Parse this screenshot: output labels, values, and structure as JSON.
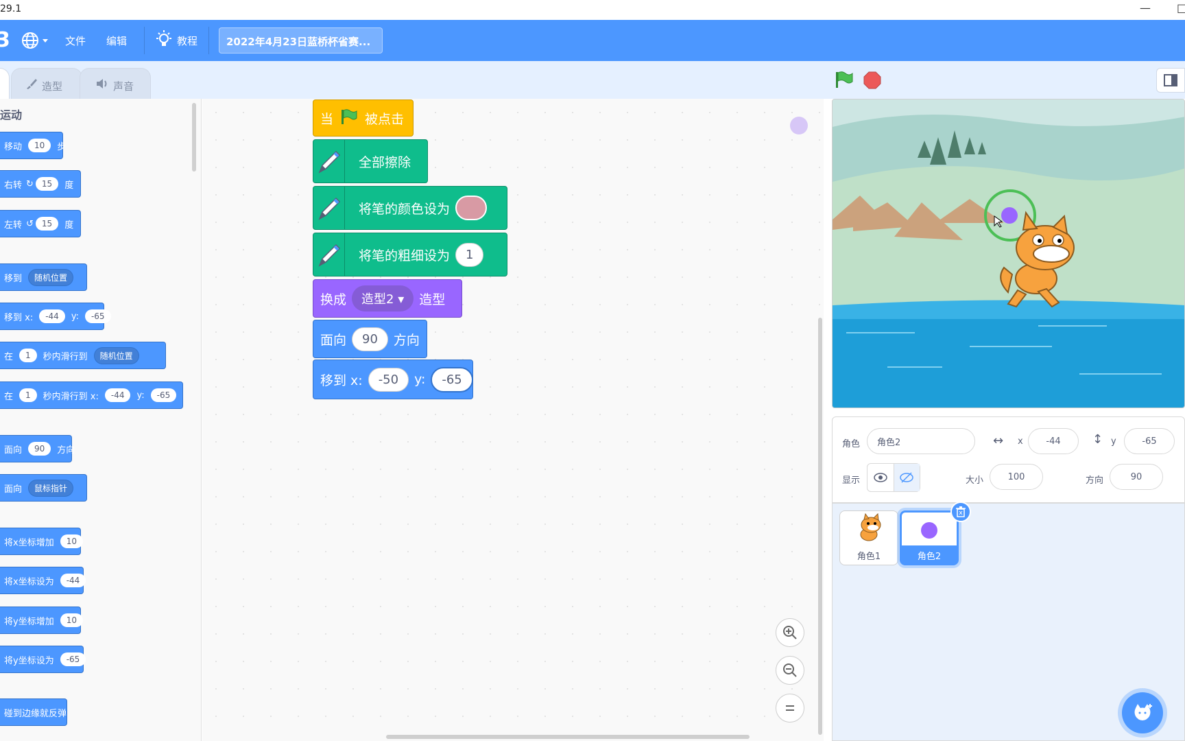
{
  "titlebar": {
    "version": "29.1",
    "minimize": "—",
    "close_partial": "□"
  },
  "menubar": {
    "menu_file": "文件",
    "menu_edit": "编辑",
    "menu_tutorials": "教程",
    "project_title": "2022年4月23日蓝桥杯省赛..."
  },
  "tabs": {
    "costumes": "造型",
    "sounds": "声音"
  },
  "palette": {
    "category": "运动",
    "blocks": {
      "move": {
        "label": "移动",
        "value": "10",
        "unit": "步"
      },
      "turn_right": {
        "label": "右转",
        "value": "15",
        "unit": "度"
      },
      "turn_left": {
        "label": "左转",
        "value": "15",
        "unit": "度"
      },
      "goto": {
        "label": "移到",
        "option": "随机位置"
      },
      "goto_xy": {
        "label": "移到 x:",
        "x": "-44",
        "ylabel": "y:",
        "y": "-65"
      },
      "glide_to": {
        "label1": "在",
        "secs": "1",
        "label2": "秒内滑行到",
        "option": "随机位置"
      },
      "glide_xy": {
        "label1": "在",
        "secs": "1",
        "label2": "秒内滑行到 x:",
        "x": "-44",
        "ylabel": "y:",
        "y": "-65"
      },
      "point_dir": {
        "label": "面向",
        "value": "90",
        "unit": "方向"
      },
      "point_towards": {
        "label": "面向",
        "option": "鼠标指针"
      },
      "change_x": {
        "label": "将x坐标增加",
        "value": "10"
      },
      "set_x": {
        "label": "将x坐标设为",
        "value": "-44"
      },
      "change_y": {
        "label": "将y坐标增加",
        "value": "10"
      },
      "set_y": {
        "label": "将y坐标设为",
        "value": "-65"
      },
      "bounce": {
        "label": "碰到边缘就反弹"
      }
    }
  },
  "script": {
    "hat": {
      "when": "当",
      "clicked": "被点击"
    },
    "erase_all": "全部擦除",
    "set_pen_color": "将笔的颜色设为",
    "set_pen_size": {
      "label": "将笔的粗细设为",
      "value": "1"
    },
    "switch_costume": {
      "label": "换成",
      "option": "造型2",
      "suffix": "造型"
    },
    "point_dir": {
      "label": "面向",
      "value": "90",
      "suffix": "方向"
    },
    "goto_xy": {
      "label": "移到 x:",
      "x": "-50",
      "ylabel": "y:",
      "y": "-65"
    }
  },
  "sprite_info": {
    "sprite_label": "角色",
    "sprite_name": "角色2",
    "x_label": "x",
    "x_value": "-44",
    "y_label": "y",
    "y_value": "-65",
    "show_label": "显示",
    "size_label": "大小",
    "size_value": "100",
    "direction_label": "方向",
    "direction_value": "90"
  },
  "sprites": [
    {
      "name": "角色1"
    },
    {
      "name": "角色2"
    }
  ],
  "colors": {
    "menubar": "#4c97ff",
    "motion": "#4c97ff",
    "pen": "#0fbd8c",
    "looks": "#9966ff",
    "events": "#ffbf00",
    "pen_color_value": "#d89aa4"
  }
}
